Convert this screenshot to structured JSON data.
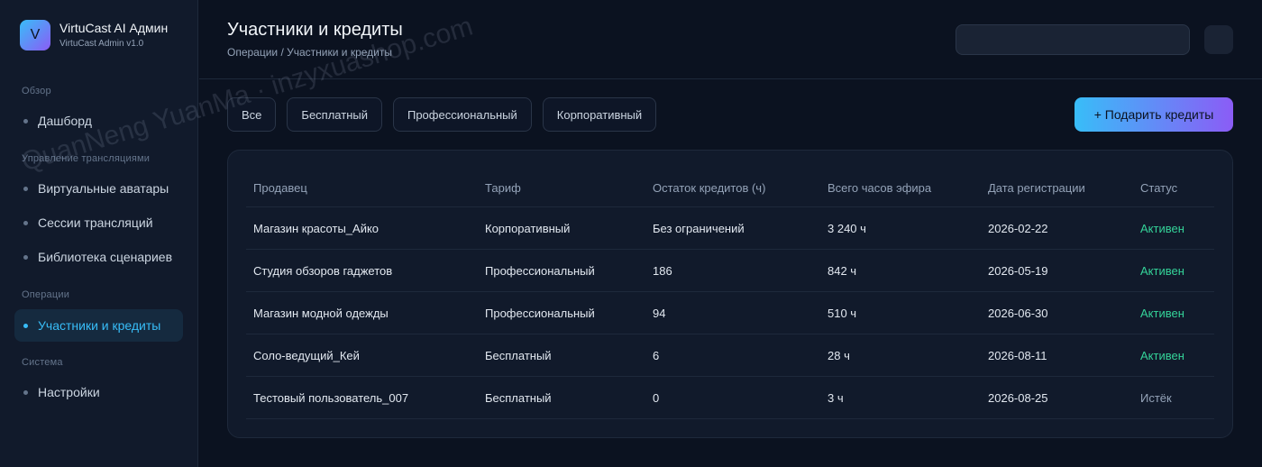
{
  "brand": {
    "logo_letter": "V",
    "title": "VirtuCast AI Админ",
    "subtitle": "VirtuCast Admin v1.0"
  },
  "sidebar": {
    "sections": [
      {
        "label": "Обзор",
        "items": [
          {
            "label": "Дашборд",
            "active": false
          }
        ]
      },
      {
        "label": "Управление трансляциями",
        "items": [
          {
            "label": "Виртуальные аватары",
            "active": false
          },
          {
            "label": "Сессии трансляций",
            "active": false
          },
          {
            "label": "Библиотека сценариев",
            "active": false
          }
        ]
      },
      {
        "label": "Операции",
        "items": [
          {
            "label": "Участники и кредиты",
            "active": true
          }
        ]
      },
      {
        "label": "Система",
        "items": [
          {
            "label": "Настройки",
            "active": false
          }
        ]
      }
    ]
  },
  "header": {
    "title": "Участники и кредиты",
    "breadcrumb": "Операции / Участники и кредиты",
    "search": {
      "value": "",
      "placeholder": ""
    }
  },
  "filters": [
    "Все",
    "Бесплатный",
    "Профессиональный",
    "Корпоративный"
  ],
  "gift_button_label": "+ Подарить кредиты",
  "table": {
    "columns": [
      "Продавец",
      "Тариф",
      "Остаток кредитов (ч)",
      "Всего часов эфира",
      "Дата регистрации",
      "Статус"
    ],
    "rows": [
      [
        "Магазин красоты_Айко",
        "Корпоративный",
        "Без ограничений",
        "3 240 ч",
        "2026-02-22",
        "Активен"
      ],
      [
        "Студия обзоров гаджетов",
        "Профессиональный",
        "186",
        "842 ч",
        "2026-05-19",
        "Активен"
      ],
      [
        "Магазин модной одежды",
        "Профессиональный",
        "94",
        "510 ч",
        "2026-06-30",
        "Активен"
      ],
      [
        "Соло-ведущий_Кей",
        "Бесплатный",
        "6",
        "28 ч",
        "2026-08-11",
        "Активен"
      ],
      [
        "Тестовый пользователь_007",
        "Бесплатный",
        "0",
        "3 ч",
        "2026-08-25",
        "Истёк"
      ]
    ]
  },
  "watermark": "QuanNeng YuanMa · inzyxuashop.com",
  "colors": {
    "accent": "#38bdf8",
    "accent2": "#8b5cf6",
    "active_status": "#34d399",
    "expired_status": "#94a3b8",
    "background": "#0b1220"
  }
}
